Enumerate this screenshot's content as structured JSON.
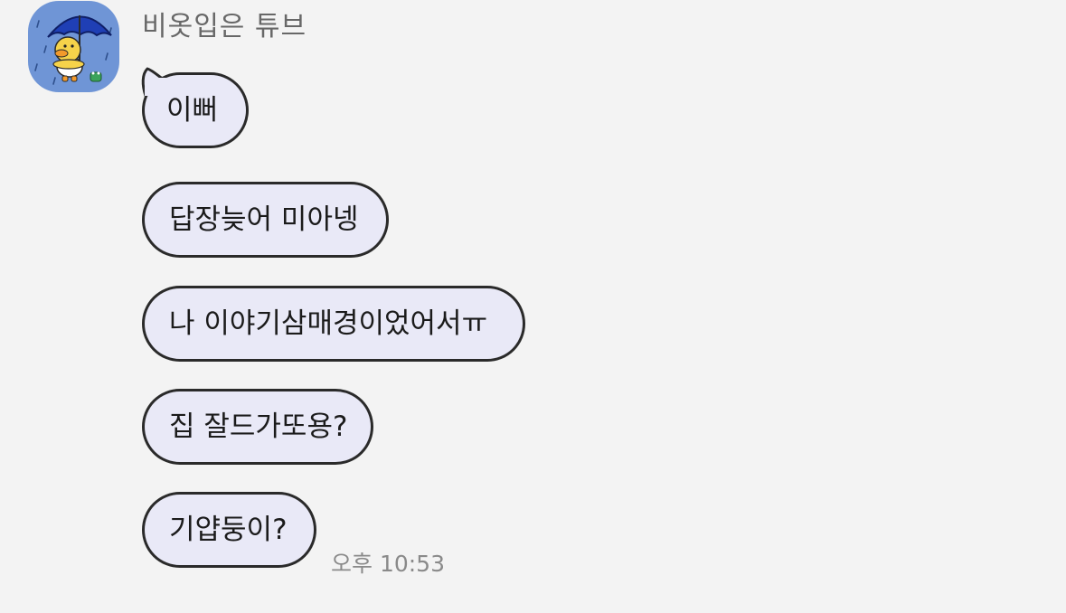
{
  "sender": {
    "name": "비옷입은 튜브",
    "avatar_icon": "tube-duck-with-umbrella-icon"
  },
  "messages": [
    {
      "text": "이뻐"
    },
    {
      "text": "답장늦어 미아넹"
    },
    {
      "text": "나 이야기삼매경이었어서ㅠ"
    },
    {
      "text": "집 잘드가또용?"
    },
    {
      "text": "기얍둥이?"
    }
  ],
  "timestamp": "오후 10:53",
  "colors": {
    "background": "#f3f3f3",
    "bubble_fill": "#e9e9f7",
    "bubble_border": "#2a2a2a",
    "avatar_bg": "#6f95d6"
  }
}
